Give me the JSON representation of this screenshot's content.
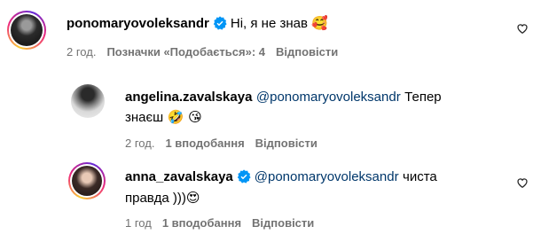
{
  "comments": [
    {
      "username": "ponomaryovoleksandr",
      "verified": true,
      "text": "Ні, я не знав",
      "emoji": "🥰",
      "time": "2 год.",
      "likes": "Позначки «Подобається»: 4",
      "reply": "Відповісти"
    },
    {
      "username": "angelina.zavalskaya",
      "verified": false,
      "mention": "@ponomaryovoleksandr",
      "text_line1": "Тепер",
      "text_line2": "знаєш",
      "emoji": "🤣 😘",
      "time": "2 год.",
      "likes": "1 вподобання",
      "reply": "Відповісти"
    },
    {
      "username": "anna_zavalskaya",
      "verified": true,
      "mention": "@ponomaryovoleksandr",
      "text_line1": "чиста",
      "text_line2": "правда )))",
      "emoji": "😍",
      "time": "1 год",
      "likes": "1 вподобання",
      "reply": "Відповісти"
    }
  ],
  "icons": {
    "like": "heart-outline-icon",
    "verified": "verified-badge-icon"
  },
  "colors": {
    "verified": "#0095f6",
    "mention": "#00376b",
    "meta": "#737373"
  }
}
